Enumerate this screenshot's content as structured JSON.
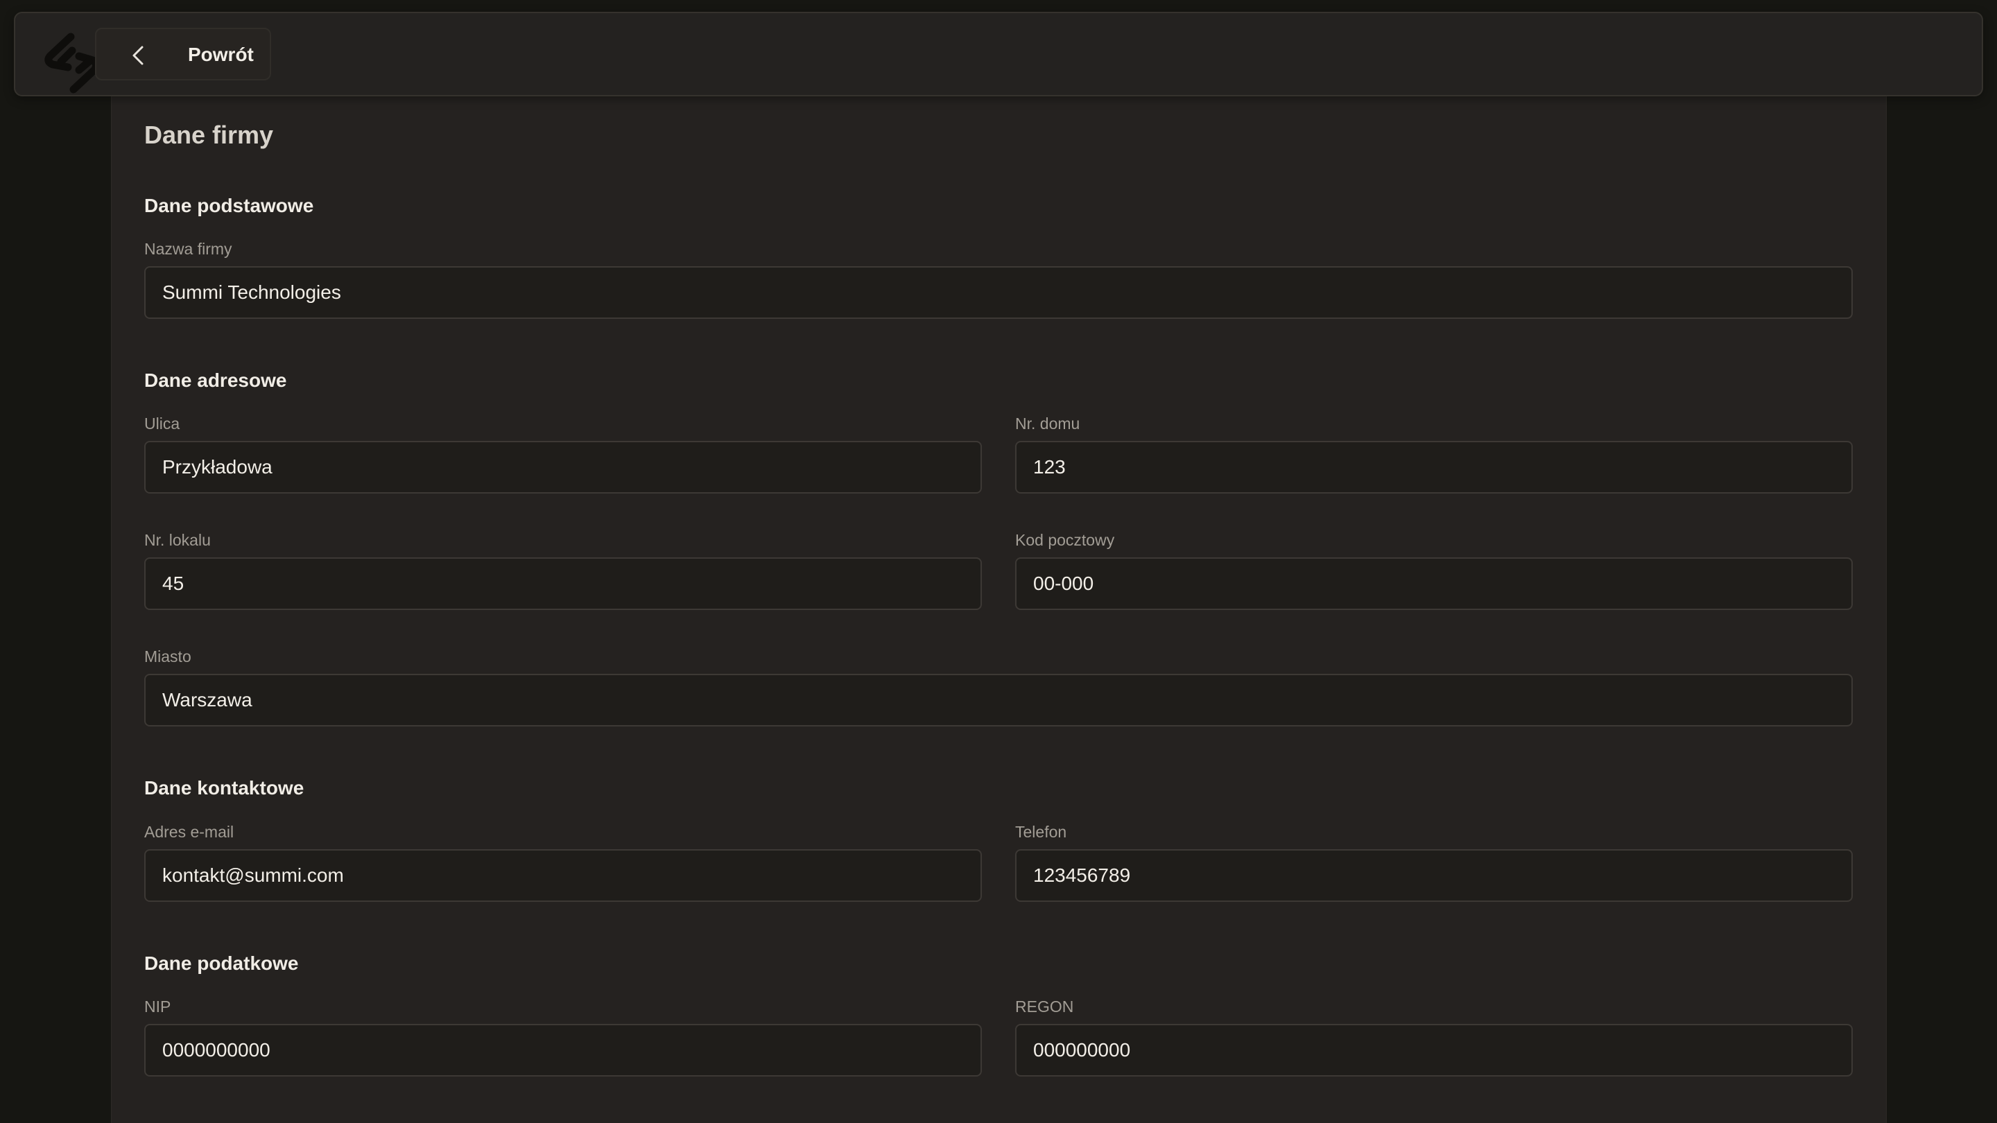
{
  "topbar": {
    "logo_icon": "brand-logo-icon",
    "back_icon": "chevron-left-icon",
    "back_label": "Powrót"
  },
  "page": {
    "title": "Dane firmy"
  },
  "sections": {
    "basic": {
      "title": "Dane podstawowe",
      "company_name": {
        "label": "Nazwa firmy",
        "value": "Summi Technologies"
      }
    },
    "address": {
      "title": "Dane adresowe",
      "street": {
        "label": "Ulica",
        "value": "Przykładowa"
      },
      "house_no": {
        "label": "Nr. domu",
        "value": "123"
      },
      "apartment_no": {
        "label": "Nr. lokalu",
        "value": "45"
      },
      "postal_code": {
        "label": "Kod pocztowy",
        "value": "00-000"
      },
      "city": {
        "label": "Miasto",
        "value": "Warszawa"
      }
    },
    "contact": {
      "title": "Dane kontaktowe",
      "email": {
        "label": "Adres e-mail",
        "value": "kontakt@summi.com"
      },
      "phone": {
        "label": "Telefon",
        "value": "123456789"
      }
    },
    "tax": {
      "title": "Dane podatkowe",
      "nip": {
        "label": "NIP",
        "value": "0000000000"
      },
      "regon": {
        "label": "REGON",
        "value": "000000000"
      }
    }
  },
  "colors": {
    "background": "#161612",
    "card": "#252220",
    "input_bg": "#1f1d1a",
    "input_border": "#3d3935",
    "text": "#f3efe8",
    "label": "#a29d95"
  }
}
